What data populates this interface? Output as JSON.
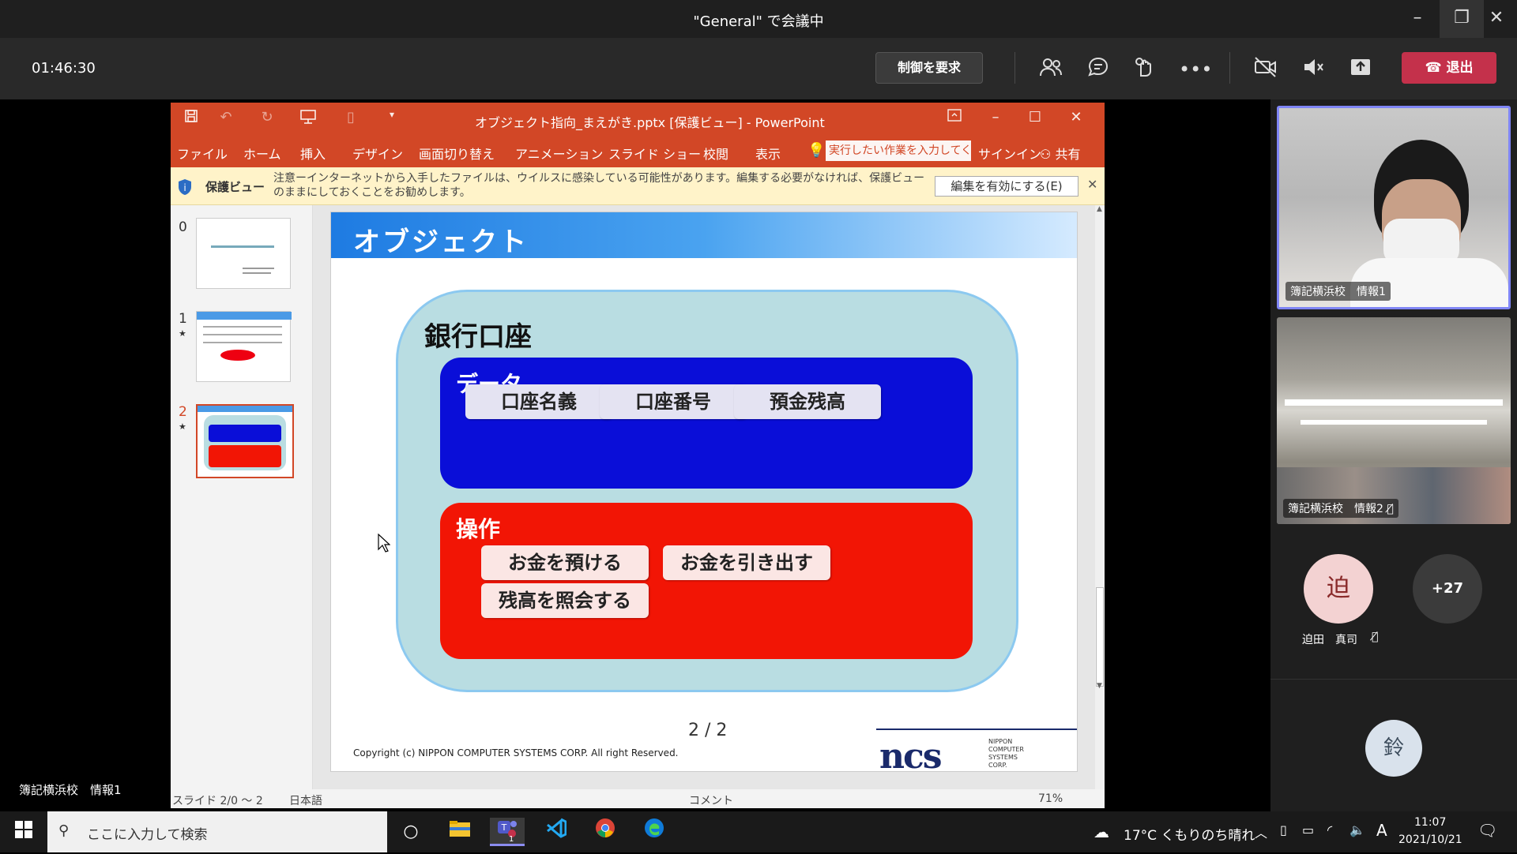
{
  "window": {
    "title": "\"General\" で会議中",
    "minimize": "–",
    "restore": "❐",
    "close": "✕"
  },
  "call": {
    "timer": "01:46:30",
    "request_control": "制御を要求",
    "leave": "退出",
    "icons": [
      "participants-icon",
      "chat-icon",
      "reactions-icon",
      "more-icon",
      "camera-off-icon",
      "mic-off-icon",
      "share-icon"
    ]
  },
  "stage": {
    "presenter_label": "簿記横浜校　情報1"
  },
  "ppt": {
    "title": "オブジェクト指向_まえがき.pptx [保護ビュー] - PowerPoint",
    "tabs": [
      "ファイル",
      "ホーム",
      "挿入",
      "デザイン",
      "画面切り替え",
      "アニメーション",
      "スライド ショー",
      "校閲",
      "表示"
    ],
    "tell_me": "実行したい作業を入力してくだ",
    "sign_in": "サインイン",
    "share": "共有",
    "protected_label": "保護ビュー",
    "protected_message": "注意ーインターネットから入手したファイルは、ウイルスに感染している可能性があります。編集する必要がなければ、保護ビューのままにしておくことをお勧めします。",
    "enable_editing": "編集を有効にする(E)",
    "thumbnails": [
      {
        "num": "0",
        "star": ""
      },
      {
        "num": "1",
        "star": "★"
      },
      {
        "num": "2",
        "star": "★"
      }
    ],
    "statusbar": {
      "slide": "スライド 2/0 ～ 2",
      "language": "日本語",
      "comments": "コメント",
      "zoom": "71%"
    }
  },
  "slide": {
    "title": "オブジェクト",
    "account_title": "銀行口座",
    "data_title": "データ",
    "data_items": [
      "口座名義",
      "口座番号",
      "預金残高"
    ],
    "op_title": "操作",
    "op_items": [
      "お金を預ける",
      "お金を引き出す",
      "残高を照会する"
    ],
    "page": "2 / 2",
    "copyright": "Copyright (c) NIPPON COMPUTER SYSTEMS CORP. All right Reserved.",
    "logo": "ncs",
    "logo_sub": "NIPPON COMPUTER SYSTEMS CORP."
  },
  "participants": {
    "tile1_label": "簿記横浜校　情報1",
    "tile2_label": "簿記横浜校　情報2",
    "avatar1_initial": "迫",
    "avatar1_name": "迫田　真司",
    "overflow": "+27",
    "avatar2_initial": "鈴"
  },
  "taskbar": {
    "search_placeholder": "ここに入力して検索",
    "weather": "17°C  くもりのち晴れ",
    "time": "11:07",
    "date": "2021/10/21",
    "ime": "A",
    "teams_badge": "1"
  },
  "colors": {
    "ppt_accent": "#d24726",
    "leave_red": "#c4314b",
    "data_blue": "#0a0ed8",
    "op_red": "#f21505",
    "active_speaker": "#7f85f5"
  }
}
